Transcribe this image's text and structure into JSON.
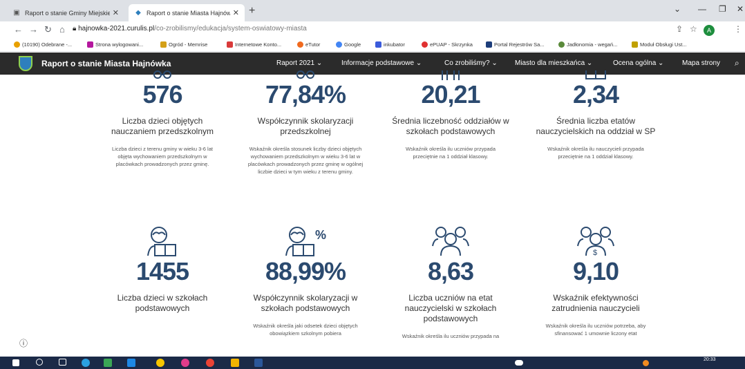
{
  "browser": {
    "tabs": [
      {
        "title": "Raport o stanie Gminy Miejskiej",
        "active": false
      },
      {
        "title": "Raport o stanie Miasta Hajnówka",
        "active": true
      }
    ],
    "url_host": "hajnowka-2021.curulis.pl",
    "url_path": "/co-zrobilismy/edukacja/system-oswiatowy-miasta",
    "profile_initial": "A",
    "bookmarks": [
      "(10190) Odebrane -...",
      "Strona wylogowani...",
      "Ogród - Memrise",
      "Internetowe Konto...",
      "eTutor",
      "Google",
      "inkubator",
      "ePUAP - Skrzynka",
      "Portal Rejestrów Sa...",
      "Jadłonomia - wegań...",
      "Moduł Obsługi Ust..."
    ]
  },
  "site": {
    "title": "Raport o stanie Miasta Hajnówka",
    "menu": [
      "Raport 2021 ⌄",
      "Informacje podstawowe ⌄",
      "Co zrobiliśmy? ⌄",
      "Miasto dla mieszkańca ⌄",
      "Ocena ogólna ⌄",
      "Mapa strony"
    ]
  },
  "stats_row1": [
    {
      "icon": "glasses-icon",
      "value": "576",
      "label": "Liczba dzieci objętych nauczaniem przedszkolnym",
      "desc": "Liczba dzieci z terenu gminy w wieku 3-6 lat objęta wychowaniem przedszkolnym w placówkach prowadzonych przez gminę."
    },
    {
      "icon": "glasses-icon",
      "value": "77,84%",
      "label": "Współczynnik skolaryzacji przedszkolnej",
      "desc": "Wskaźnik określa stosunek liczby dzieci objętych wychowaniem przedszkolnym w wieku 3-6 lat w placówkach prowadzonych przez gminę w ogólnej liczbie dzieci w tym wieku z terenu gminy."
    },
    {
      "icon": "desk-icon",
      "value": "20,21",
      "label": "Średnia liczebność oddziałów w szkołach podstawowych",
      "desc": "Wskaźnik określa ilu uczniów przypada przeciętnie na 1 oddział klasowy."
    },
    {
      "icon": "book-icon",
      "value": "2,34",
      "label": "Średnia liczba etatów nauczycielskich na oddział w SP",
      "desc": "Wskaźnik określa ilu nauczycieli przypada przeciętnie na 1 oddział klasowy."
    }
  ],
  "stats_row2": [
    {
      "icon": "reader-icon",
      "value": "1455",
      "label": "Liczba dzieci w szkołach podstawowych",
      "desc": ""
    },
    {
      "icon": "reader-percent-icon",
      "value": "88,99%",
      "label": "Współczynnik skolaryzacji w szkołach podstawowych",
      "desc": "Wskaźnik określa jaki odsetek dzieci objętych obowiązkiem szkolnym pobiera"
    },
    {
      "icon": "group-icon",
      "value": "8,63",
      "label": "Liczba uczniów na etat nauczycielski w szkołach podstawowych",
      "desc": "Wskaźnik określa ilu uczniów przypada na"
    },
    {
      "icon": "group-money-icon",
      "value": "9,10",
      "label": "Wskaźnik efektywności zatrudnienia nauczycieli",
      "desc": "Wskaźnik określa ilu uczniów potrzeba, aby sfinansować 1 umownie liczony etat"
    }
  ],
  "taskbar": {
    "time": "20:33"
  },
  "colors": {
    "accent": "#2b4a6f",
    "header_bg": "#2b2b2b",
    "taskbar_bg": "#1b2a47"
  }
}
